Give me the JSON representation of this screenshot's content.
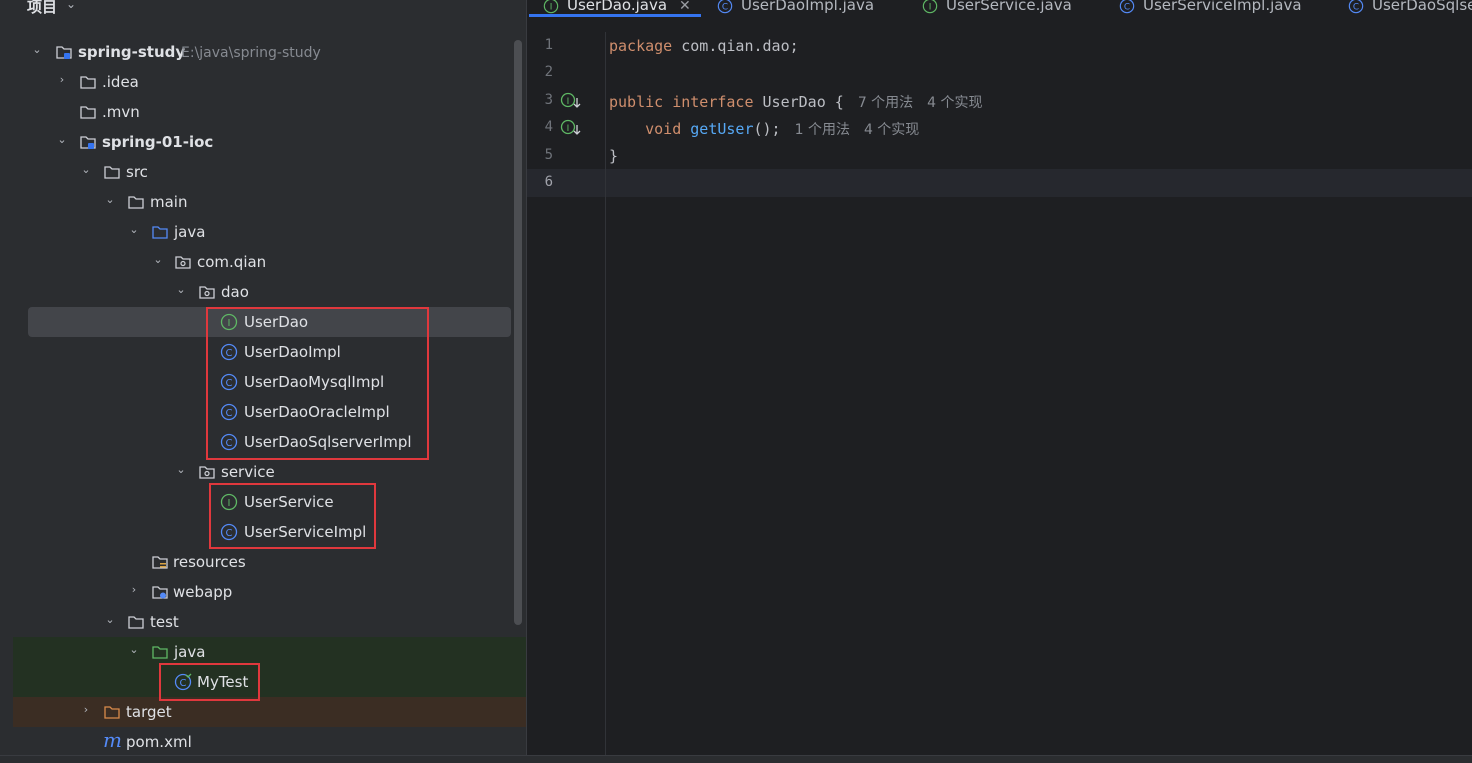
{
  "project_panel": {
    "title": "项目",
    "rows": [
      {
        "label": "spring-study",
        "path": "E:\\java\\spring-study"
      },
      {
        "label": ".idea"
      },
      {
        "label": ".mvn"
      },
      {
        "label": "spring-01-ioc"
      },
      {
        "label": "src"
      },
      {
        "label": "main"
      },
      {
        "label": "java"
      },
      {
        "label": "com.qian"
      },
      {
        "label": "dao"
      },
      {
        "label": "UserDao",
        "icon_letter": "I"
      },
      {
        "label": "UserDaoImpl",
        "icon_letter": "C"
      },
      {
        "label": "UserDaoMysqlImpl",
        "icon_letter": "C"
      },
      {
        "label": "UserDaoOracleImpl",
        "icon_letter": "C"
      },
      {
        "label": "UserDaoSqlserverImpl",
        "icon_letter": "C"
      },
      {
        "label": "service"
      },
      {
        "label": "UserService",
        "icon_letter": "I"
      },
      {
        "label": "UserServiceImpl",
        "icon_letter": "C"
      },
      {
        "label": "resources"
      },
      {
        "label": "webapp"
      },
      {
        "label": "test"
      },
      {
        "label": "java"
      },
      {
        "label": "MyTest",
        "icon_letter": "C"
      },
      {
        "label": "target"
      },
      {
        "label": "pom.xml",
        "icon_letter": "m"
      }
    ]
  },
  "tabs": [
    {
      "label": "UserDao.java",
      "icon_letter": "I"
    },
    {
      "label": "UserDaoImpl.java",
      "icon_letter": "C"
    },
    {
      "label": "UserService.java",
      "icon_letter": "I"
    },
    {
      "label": "UserServiceImpl.java",
      "icon_letter": "C"
    },
    {
      "label": "UserDaoSqlse",
      "icon_letter": "C"
    }
  ],
  "editor": {
    "line_numbers": [
      "1",
      "2",
      "3",
      "4",
      "5",
      "6"
    ],
    "line1": {
      "kw": "package",
      "rest": " com.qian.dao;"
    },
    "line3": {
      "kw1": "public",
      "kw2": "interface",
      "rest": " UserDao {",
      "hint_usages": "7 个用法",
      "hint_impls": "4 个实现"
    },
    "line4": {
      "kw": "void",
      "fn": "getUser",
      "rest": "();",
      "hint_usages": "1 个用法",
      "hint_impls": "4 个实现"
    },
    "line5": {
      "text": "}"
    }
  },
  "colors": {
    "interface_icon": "#5fb865",
    "class_icon": "#548af7",
    "highlight_box": "#e0383d",
    "keyword": "#cf8e6d",
    "function": "#56a8f5"
  }
}
